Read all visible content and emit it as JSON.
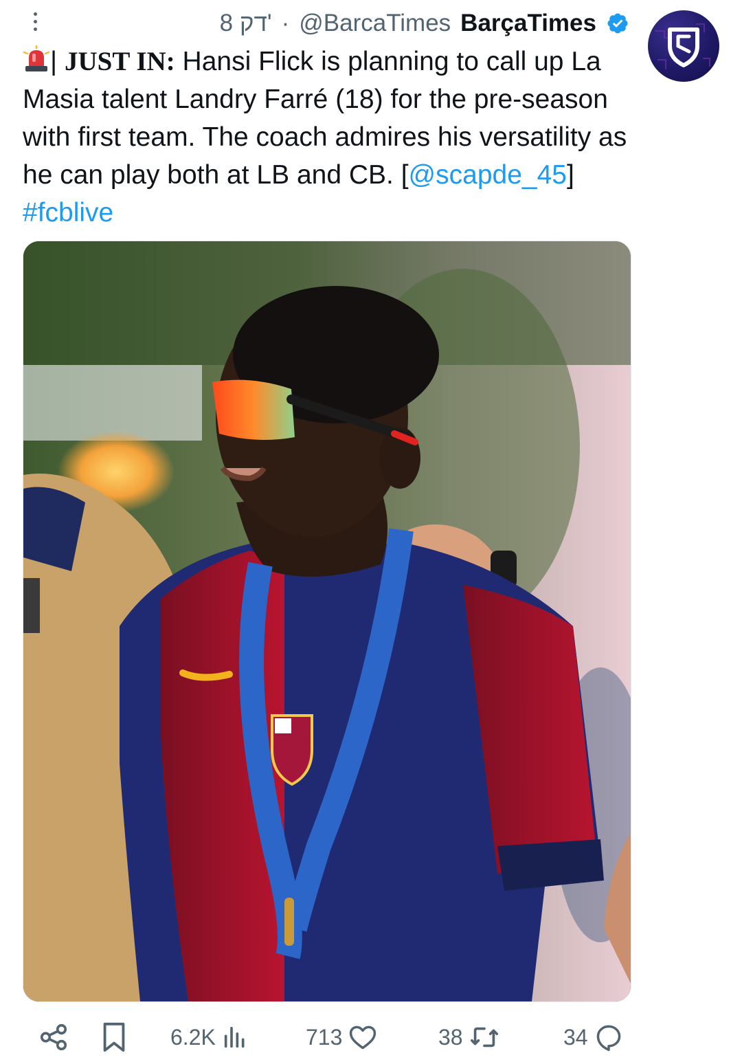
{
  "header": {
    "time": "8 דק'",
    "separator": "·",
    "handle": "@BarcaTimes",
    "display_name": "BarçaTimes",
    "verified": true
  },
  "avatar": {
    "icon": "barcatimes-shield-logo"
  },
  "tweet": {
    "siren_icon": "police-light-icon",
    "prefix": "| ",
    "bold_label": "JUST IN:",
    "body": " Hansi Flick is planning to call up La Masia talent Landry Farré (18) for the pre-season with first team. The coach admires his versatility as he can play both at LB and CB. [",
    "mention": "@scapde_45",
    "after_mention": "] ",
    "hashtag": "#fcblive"
  },
  "media": {
    "alt": "Player in red and blue kit wearing mirrored sunglasses and a UEFA Youth League medal"
  },
  "actions": {
    "share_icon": "share-icon",
    "bookmark_icon": "bookmark-icon",
    "views": "6.2K",
    "views_icon": "views-chart-icon",
    "likes": "713",
    "likes_icon": "heart-icon",
    "retweets": "38",
    "retweets_icon": "retweet-icon",
    "replies": "34",
    "replies_icon": "reply-icon"
  },
  "colors": {
    "link": "#1d9bf0",
    "verified": "#1d9bf0",
    "muted": "#536471",
    "text": "#0f1419"
  }
}
